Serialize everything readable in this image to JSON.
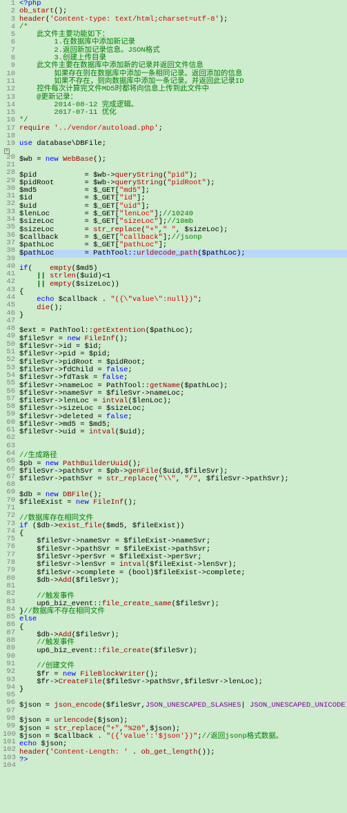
{
  "lines": [
    {
      "n": 1,
      "h": "<span class='kw'>&lt;?php</span>"
    },
    {
      "n": 2,
      "h": "<span class='fn'>ob_start</span>();"
    },
    {
      "n": 3,
      "h": "<span class='fn'>header</span>(<span class='str'>'Content-type: text/html;charset=utf-8'</span>);"
    },
    {
      "n": 4,
      "h": "<span class='com'>/*</span>"
    },
    {
      "n": 5,
      "h": "<span class='com'>    此文件主要功能如下：</span>"
    },
    {
      "n": 6,
      "h": "<span class='com'>        1.在数据库中添加新记录</span>"
    },
    {
      "n": 7,
      "h": "<span class='com'>        2.返回新加记录信息。JSON格式</span>"
    },
    {
      "n": 8,
      "h": "<span class='com'>        3.创建上传目录</span>"
    },
    {
      "n": 9,
      "h": "<span class='com'>    此文件主要在数据库中添加新的记录并返回文件信息</span>"
    },
    {
      "n": 10,
      "h": "<span class='com'>        如果存在则在数据库中添加一条相同记录。返回添加的信息</span>"
    },
    {
      "n": 11,
      "h": "<span class='com'>        如果不存在，则向数据库中添加一条记录。并返回此记录ID</span>"
    },
    {
      "n": 12,
      "h": "<span class='com'>    控件每次计算完文件MD5时都将向信息上传到此文件中</span>"
    },
    {
      "n": 13,
      "h": "<span class='com'>    @更新记录：</span>"
    },
    {
      "n": 14,
      "h": "<span class='com'>        2014-08-12 完成逻辑。</span>"
    },
    {
      "n": 15,
      "h": "<span class='com'>        2017-07-11 优化</span>"
    },
    {
      "n": 16,
      "h": "<span class='com'>*/</span>"
    },
    {
      "n": 17,
      "h": "<span class='fn'>require</span> <span class='str'>'../vendor/autoload.php'</span>;"
    },
    {
      "n": 18,
      "h": ""
    },
    {
      "n": 19,
      "h": "<span class='kw'>use</span> database\\DBFile;",
      "fold": true
    },
    {
      "n": 20,
      "h": ""
    },
    {
      "n": 21,
      "h": "$wb = <span class='kw'>new</span> <span class='fn'>WebBase</span>();"
    },
    {
      "n": 28,
      "h": ""
    },
    {
      "n": 29,
      "h": "$pid           = $wb-&gt;<span class='fn'>queryString</span>(<span class='str'>\"pid\"</span>);"
    },
    {
      "n": 30,
      "h": "$pidRoot       = $wb-&gt;<span class='fn'>queryString</span>(<span class='str'>\"pidRoot\"</span>);"
    },
    {
      "n": 31,
      "h": "$md5           = $_GET[<span class='str'>\"md5\"</span>];"
    },
    {
      "n": 32,
      "h": "$id            = $_GET[<span class='str'>\"id\"</span>];"
    },
    {
      "n": 33,
      "h": "$uid           = $_GET[<span class='str'>\"uid\"</span>];"
    },
    {
      "n": 34,
      "h": "$lenLoc        = $_GET[<span class='str'>\"lenLoc\"</span>];<span class='com'>//10240</span>"
    },
    {
      "n": 35,
      "h": "$sizeLoc       = $_GET[<span class='str'>\"sizeLoc\"</span>];<span class='com'>//10mb</span>"
    },
    {
      "n": 36,
      "h": "$sizeLoc       = <span class='fn'>str_replace</span>(<span class='str'>\"+\"</span>,<span class='str'>\" \"</span>, $sizeLoc);"
    },
    {
      "n": 37,
      "h": "$callback      = $_GET[<span class='str'>\"callback\"</span>];<span class='com'>//jsonp</span>"
    },
    {
      "n": 38,
      "h": "$pathLoc       = $_GET[<span class='str'>\"pathLoc\"</span>];"
    },
    {
      "n": 39,
      "h": "$pathLoc       = PathTool::<span class='fn'>urldecode_path</span>($pathLoc);",
      "hl": true
    },
    {
      "n": 40,
      "h": ""
    },
    {
      "n": 41,
      "h": "<span class='kw'>if</span>(    <span class='fn'>empty</span>($md5)"
    },
    {
      "n": 42,
      "h": "    <span class='op'>||</span> <span class='fn'>strlen</span>($uid)&lt;1"
    },
    {
      "n": 43,
      "h": "    <span class='op'>||</span> <span class='fn'>empty</span>($sizeLoc))"
    },
    {
      "n": 44,
      "h": "{"
    },
    {
      "n": 45,
      "h": "    <span class='kw'>echo</span> $callback . <span class='str'>\"({\\\"value\\\":null})\"</span>;"
    },
    {
      "n": 46,
      "h": "    <span class='fn'>die</span>();"
    },
    {
      "n": 47,
      "h": "}"
    },
    {
      "n": 48,
      "h": ""
    },
    {
      "n": 49,
      "h": "$ext = PathTool::<span class='fn'>getExtention</span>($pathLoc);"
    },
    {
      "n": 50,
      "h": "$fileSvr = <span class='kw'>new</span> <span class='fn'>FileInf</span>();"
    },
    {
      "n": 51,
      "h": "$fileSvr-&gt;id = $id;"
    },
    {
      "n": 52,
      "h": "$fileSvr-&gt;pid = $pid;"
    },
    {
      "n": 53,
      "h": "$fileSvr-&gt;pidRoot = $pidRoot;"
    },
    {
      "n": 54,
      "h": "$fileSvr-&gt;fdChild = <span class='kw'>false</span>;"
    },
    {
      "n": 55,
      "h": "$fileSvr-&gt;fdTask = <span class='kw'>false</span>;"
    },
    {
      "n": 56,
      "h": "$fileSvr-&gt;nameLoc = PathTool::<span class='fn'>getName</span>($pathLoc);"
    },
    {
      "n": 57,
      "h": "$fileSvr-&gt;nameSvr = $fileSvr-&gt;nameLoc;"
    },
    {
      "n": 58,
      "h": "$fileSvr-&gt;lenLoc = <span class='fn'>intval</span>($lenLoc);"
    },
    {
      "n": 59,
      "h": "$fileSvr-&gt;sizeLoc = $sizeLoc;"
    },
    {
      "n": 60,
      "h": "$fileSvr-&gt;deleted = <span class='kw'>false</span>;"
    },
    {
      "n": 61,
      "h": "$fileSvr-&gt;md5 = $md5;"
    },
    {
      "n": 62,
      "h": "$fileSvr-&gt;uid = <span class='fn'>intval</span>($uid);"
    },
    {
      "n": 63,
      "h": ""
    },
    {
      "n": 64,
      "h": ""
    },
    {
      "n": 65,
      "h": "<span class='com'>//生成路径</span>"
    },
    {
      "n": 66,
      "h": "$pb = <span class='kw'>new</span> <span class='fn'>PathBuilderUuid</span>();"
    },
    {
      "n": 67,
      "h": "$fileSvr-&gt;pathSvr = $pb-&gt;<span class='fn'>genFile</span>($uid,$fileSvr);"
    },
    {
      "n": 68,
      "h": "$fileSvr-&gt;pathSvr = <span class='fn'>str_replace</span>(<span class='str'>\"\\\\\"</span>, <span class='str'>\"/\"</span>, $fileSvr-&gt;pathSvr);"
    },
    {
      "n": 69,
      "h": ""
    },
    {
      "n": 70,
      "h": "$db = <span class='kw'>new</span> <span class='fn'>DBFile</span>();"
    },
    {
      "n": 71,
      "h": "$fileExist = <span class='kw'>new</span> <span class='fn'>FileInf</span>();"
    },
    {
      "n": 72,
      "h": ""
    },
    {
      "n": 73,
      "h": "<span class='com'>//数据库存在相同文件</span>"
    },
    {
      "n": 74,
      "h": "<span class='kw'>if</span> ($db-&gt;<span class='fn'>exist_file</span>($md5, $fileExist))"
    },
    {
      "n": 75,
      "h": "{"
    },
    {
      "n": 76,
      "h": "    $fileSvr-&gt;nameSvr = $fileExist-&gt;nameSvr;"
    },
    {
      "n": 77,
      "h": "    $fileSvr-&gt;pathSvr = $fileExist-&gt;pathSvr;"
    },
    {
      "n": 78,
      "h": "    $fileSvr-&gt;perSvr = $fileExist-&gt;perSvr;"
    },
    {
      "n": 79,
      "h": "    $fileSvr-&gt;lenSvr = <span class='fn'>intval</span>($fileExist-&gt;lenSvr);"
    },
    {
      "n": 80,
      "h": "    $fileSvr-&gt;complete = (bool)$fileExist-&gt;complete;"
    },
    {
      "n": 81,
      "h": "    $db-&gt;<span class='fn'>Add</span>($fileSvr);"
    },
    {
      "n": 82,
      "h": ""
    },
    {
      "n": 83,
      "h": "    <span class='com'>//触发事件</span>"
    },
    {
      "n": 84,
      "h": "    up6_biz_event::<span class='fn'>file_create_same</span>($fileSvr);"
    },
    {
      "n": 85,
      "h": "}<span class='com'>//数据库不存在相同文件</span>"
    },
    {
      "n": 86,
      "h": "<span class='kw'>else</span>"
    },
    {
      "n": 87,
      "h": "{"
    },
    {
      "n": 88,
      "h": "    $db-&gt;<span class='fn'>Add</span>($fileSvr);"
    },
    {
      "n": 89,
      "h": "    <span class='com'>//触发事件</span>"
    },
    {
      "n": 90,
      "h": "    up6_biz_event::<span class='fn'>file_create</span>($fileSvr);"
    },
    {
      "n": 91,
      "h": ""
    },
    {
      "n": 92,
      "h": "    <span class='com'>//创建文件</span>"
    },
    {
      "n": 93,
      "h": "    $fr = <span class='kw'>new</span> <span class='fn'>FileBlockWriter</span>();"
    },
    {
      "n": 94,
      "h": "    $fr-&gt;<span class='fn'>CreateFile</span>($fileSvr-&gt;pathSvr,$fileSvr-&gt;lenLoc);"
    },
    {
      "n": 95,
      "h": "}"
    },
    {
      "n": 96,
      "h": ""
    },
    {
      "n": 97,
      "h": "$json = <span class='fn'>json_encode</span>($fileSvr,<span class='const'>JSON_UNESCAPED_SLASHES</span>| <span class='const'>JSON_UNESCAPED_UNICODE</span>);"
    },
    {
      "n": 98,
      "h": ""
    },
    {
      "n": 99,
      "h": "$json = <span class='fn'>urlencode</span>($json);"
    },
    {
      "n": 100,
      "h": "$json = <span class='fn'>str_replace</span>(<span class='str'>\"+\"</span>,<span class='str'>\"%20\"</span>,$json);"
    },
    {
      "n": 101,
      "h": "$json = $callback . <span class='str'>\"({'value':'$json'})\"</span>;<span class='com'>//返回jsonp格式数据。</span>"
    },
    {
      "n": 102,
      "h": "<span class='kw'>echo</span> $json;"
    },
    {
      "n": 103,
      "h": "<span class='fn'>header</span>(<span class='str'>'Content-Length: '</span> . <span class='fn'>ob_get_length</span>());"
    },
    {
      "n": 104,
      "h": "<span class='kw'>?&gt;</span>"
    }
  ]
}
